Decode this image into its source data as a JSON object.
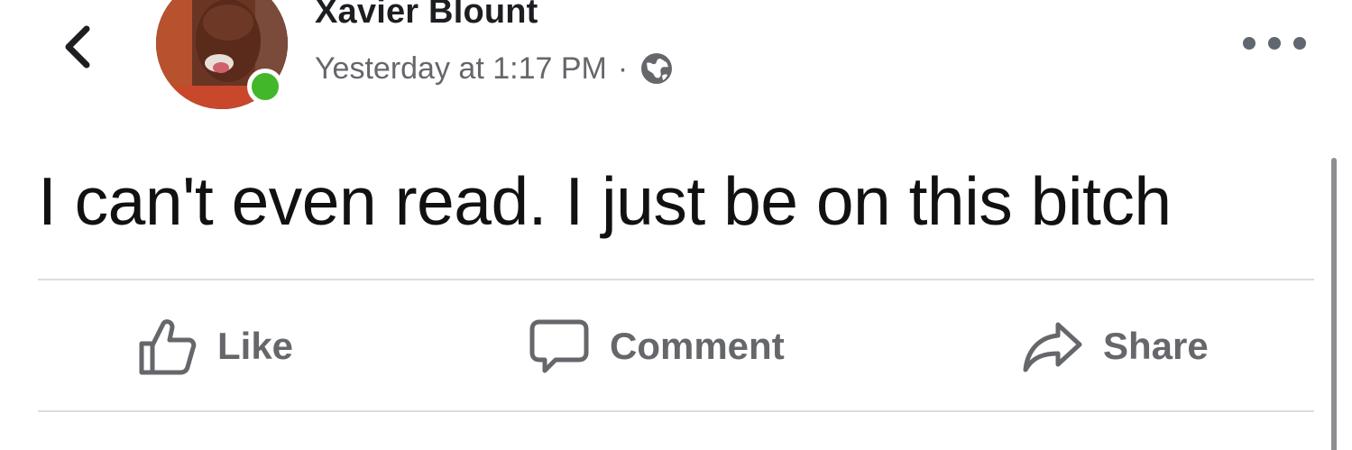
{
  "post": {
    "author_name": "Xavier Blount",
    "timestamp": "Yesterday at 1:17 PM",
    "separator": "·",
    "privacy_icon": "globe-icon",
    "text": "I can't even read. I just be on this bitch",
    "author_online": true
  },
  "actions": {
    "like_label": "Like",
    "comment_label": "Comment",
    "share_label": "Share"
  },
  "colors": {
    "online_status": "#42b72a",
    "secondary_text": "#65676b",
    "primary_text": "#1c1e21"
  }
}
